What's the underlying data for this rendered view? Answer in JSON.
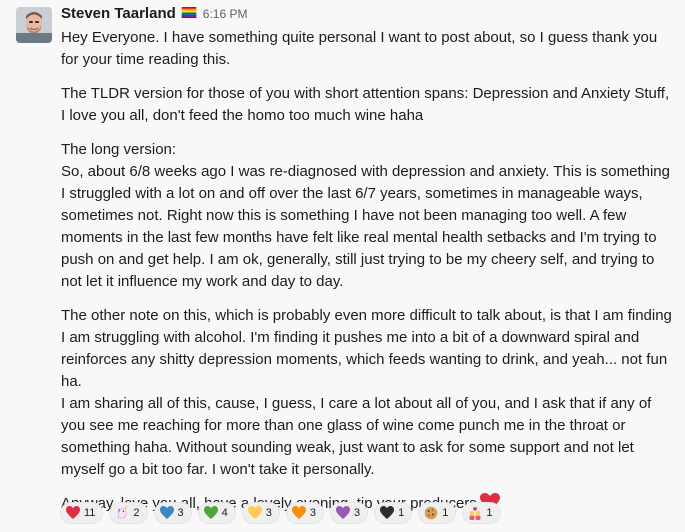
{
  "message": {
    "author": "Steven Taarland",
    "author_flag_icon": "rainbow-flag-icon",
    "timestamp": "6:16 PM",
    "paragraphs": [
      "Hey Everyone. I have something quite personal I want to post about, so I guess thank you for your time reading this.",
      "The TLDR version for those of you with short attention spans: Depression and Anxiety Stuff, I love you all, don't feed the homo too much wine haha",
      "The long version:",
      "So, about 6/8 weeks ago I was re-diagnosed with depression and anxiety. This is something I struggled with a lot on and off over the last 6/7 years, sometimes in manageable ways, sometimes not. Right now this is something I have not been managing too well. A few moments in the last few months have felt like real mental health setbacks and I'm trying to push on and get help. I am ok, generally, still just trying to be my cheery self, and trying to not let it influence my work and day to day.",
      "The other note on this, which is probably even more difficult to talk about, is that I am finding I am struggling with alcohol. I'm finding it pushes me into a bit of a downward spiral and reinforces any shitty depression moments, which feeds wanting to drink, and yeah... not fun ha.",
      "I am sharing all of this, cause, I guess, I care a lot about all of you, and I ask that if any of you see me reaching for more than one glass of wine come punch me in the throat or something haha. Without sounding weak, just want to ask for some support and not let myself go a bit too far. I won't take it personally.",
      "Anyway, love you all, have a lovely evening, tip your producers"
    ],
    "closing_emoji": "red-heart-icon"
  },
  "reactions": [
    {
      "icon": "red-heart-icon",
      "count": "11",
      "color": "#dd2e44"
    },
    {
      "icon": "unicorn-icon",
      "count": "2",
      "color": "#e9a7d6"
    },
    {
      "icon": "blue-heart-icon",
      "count": "3",
      "color": "#3b88c3"
    },
    {
      "icon": "green-heart-icon",
      "count": "4",
      "color": "#4fa33b"
    },
    {
      "icon": "yellow-heart-icon",
      "count": "3",
      "color": "#fdcb58"
    },
    {
      "icon": "orange-heart-icon",
      "count": "3",
      "color": "#f4900c"
    },
    {
      "icon": "purple-heart-icon",
      "count": "3",
      "color": "#9b59b6"
    },
    {
      "icon": "black-heart-icon",
      "count": "1",
      "color": "#292f33"
    },
    {
      "icon": "cookie-icon",
      "count": "1",
      "color": "#d99e5c"
    },
    {
      "icon": "couple-with-heart-icon",
      "count": "1",
      "color": "#f7a8b8"
    }
  ]
}
